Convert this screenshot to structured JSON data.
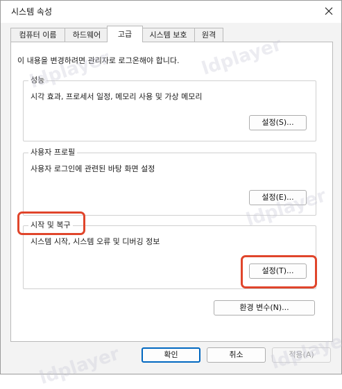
{
  "window": {
    "title": "시스템 속성",
    "close_icon": "close-icon"
  },
  "tabs": [
    {
      "label": "컴퓨터 이름",
      "selected": false
    },
    {
      "label": "하드웨어",
      "selected": false
    },
    {
      "label": "고급",
      "selected": true
    },
    {
      "label": "시스템 보호",
      "selected": false
    },
    {
      "label": "원격",
      "selected": false
    }
  ],
  "advanced": {
    "intro": "이 내용을 변경하려면 관리자로 로그온해야 합니다.",
    "performance": {
      "label": "성능",
      "description": "시각 효과, 프로세서 일정, 메모리 사용 및 가상 메모리",
      "button": "설정(S)..."
    },
    "user_profiles": {
      "label": "사용자 프로필",
      "description": "사용자 로그인에 관련된 바탕 화면 설정",
      "button": "설정(E)..."
    },
    "startup_recovery": {
      "label": "시작 및 복구",
      "description": "시스템 시작, 시스템 오류 및 디버깅 정보",
      "button": "설정(T)..."
    },
    "env_button": "환경 변수(N)..."
  },
  "footer": {
    "ok": "확인",
    "cancel": "취소",
    "apply": "적용(A)"
  },
  "watermark": "ldplayer",
  "colors": {
    "highlight": "#e0452b",
    "default_button_border": "#0067c0"
  }
}
